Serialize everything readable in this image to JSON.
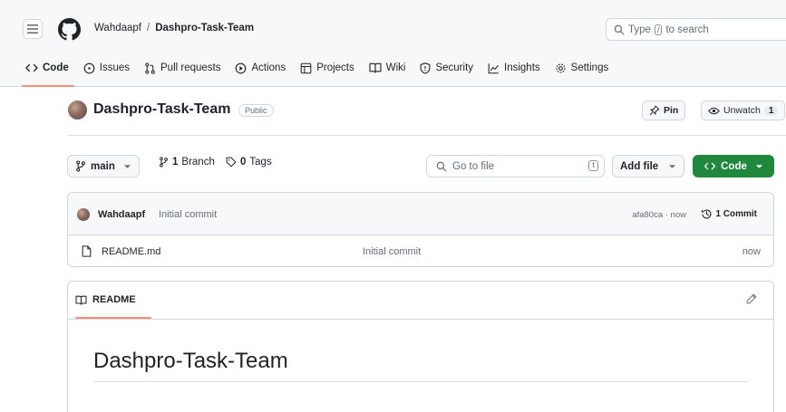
{
  "header": {
    "owner": "Wahdaapf",
    "separator": "/",
    "repo": "Dashpro-Task-Team",
    "search_prefix": "Type",
    "search_kbd": "/",
    "search_suffix": "to search"
  },
  "tabs": [
    {
      "label": "Code",
      "icon": "code-icon"
    },
    {
      "label": "Issues",
      "icon": "issue-icon"
    },
    {
      "label": "Pull requests",
      "icon": "pull-request-icon"
    },
    {
      "label": "Actions",
      "icon": "play-icon"
    },
    {
      "label": "Projects",
      "icon": "table-icon"
    },
    {
      "label": "Wiki",
      "icon": "book-icon"
    },
    {
      "label": "Security",
      "icon": "shield-icon"
    },
    {
      "label": "Insights",
      "icon": "graph-icon"
    },
    {
      "label": "Settings",
      "icon": "gear-icon"
    }
  ],
  "repo_head": {
    "title": "Dashpro-Task-Team",
    "visibility": "Public",
    "pin_label": "Pin",
    "unwatch_label": "Unwatch",
    "watch_count": "1"
  },
  "toolbar": {
    "branch": "main",
    "branch_count": "1",
    "branch_label": "Branch",
    "tag_count": "0",
    "tag_label": "Tags",
    "goto_placeholder": "Go to file",
    "goto_kbd": "t",
    "add_file_label": "Add file",
    "code_label": "Code"
  },
  "commit": {
    "author": "Wahdaapf",
    "message": "Initial commit",
    "sha_time": "afa80ca · now",
    "count_label": "1 Commit"
  },
  "files": [
    {
      "name": "README.md",
      "commit": "Initial commit",
      "time": "now"
    }
  ],
  "readme": {
    "tab_label": "README",
    "heading": "Dashpro-Task-Team"
  },
  "colors": {
    "accent_orange": "#fd8c73",
    "code_button": "#1f883d",
    "border": "#d0d7de"
  }
}
